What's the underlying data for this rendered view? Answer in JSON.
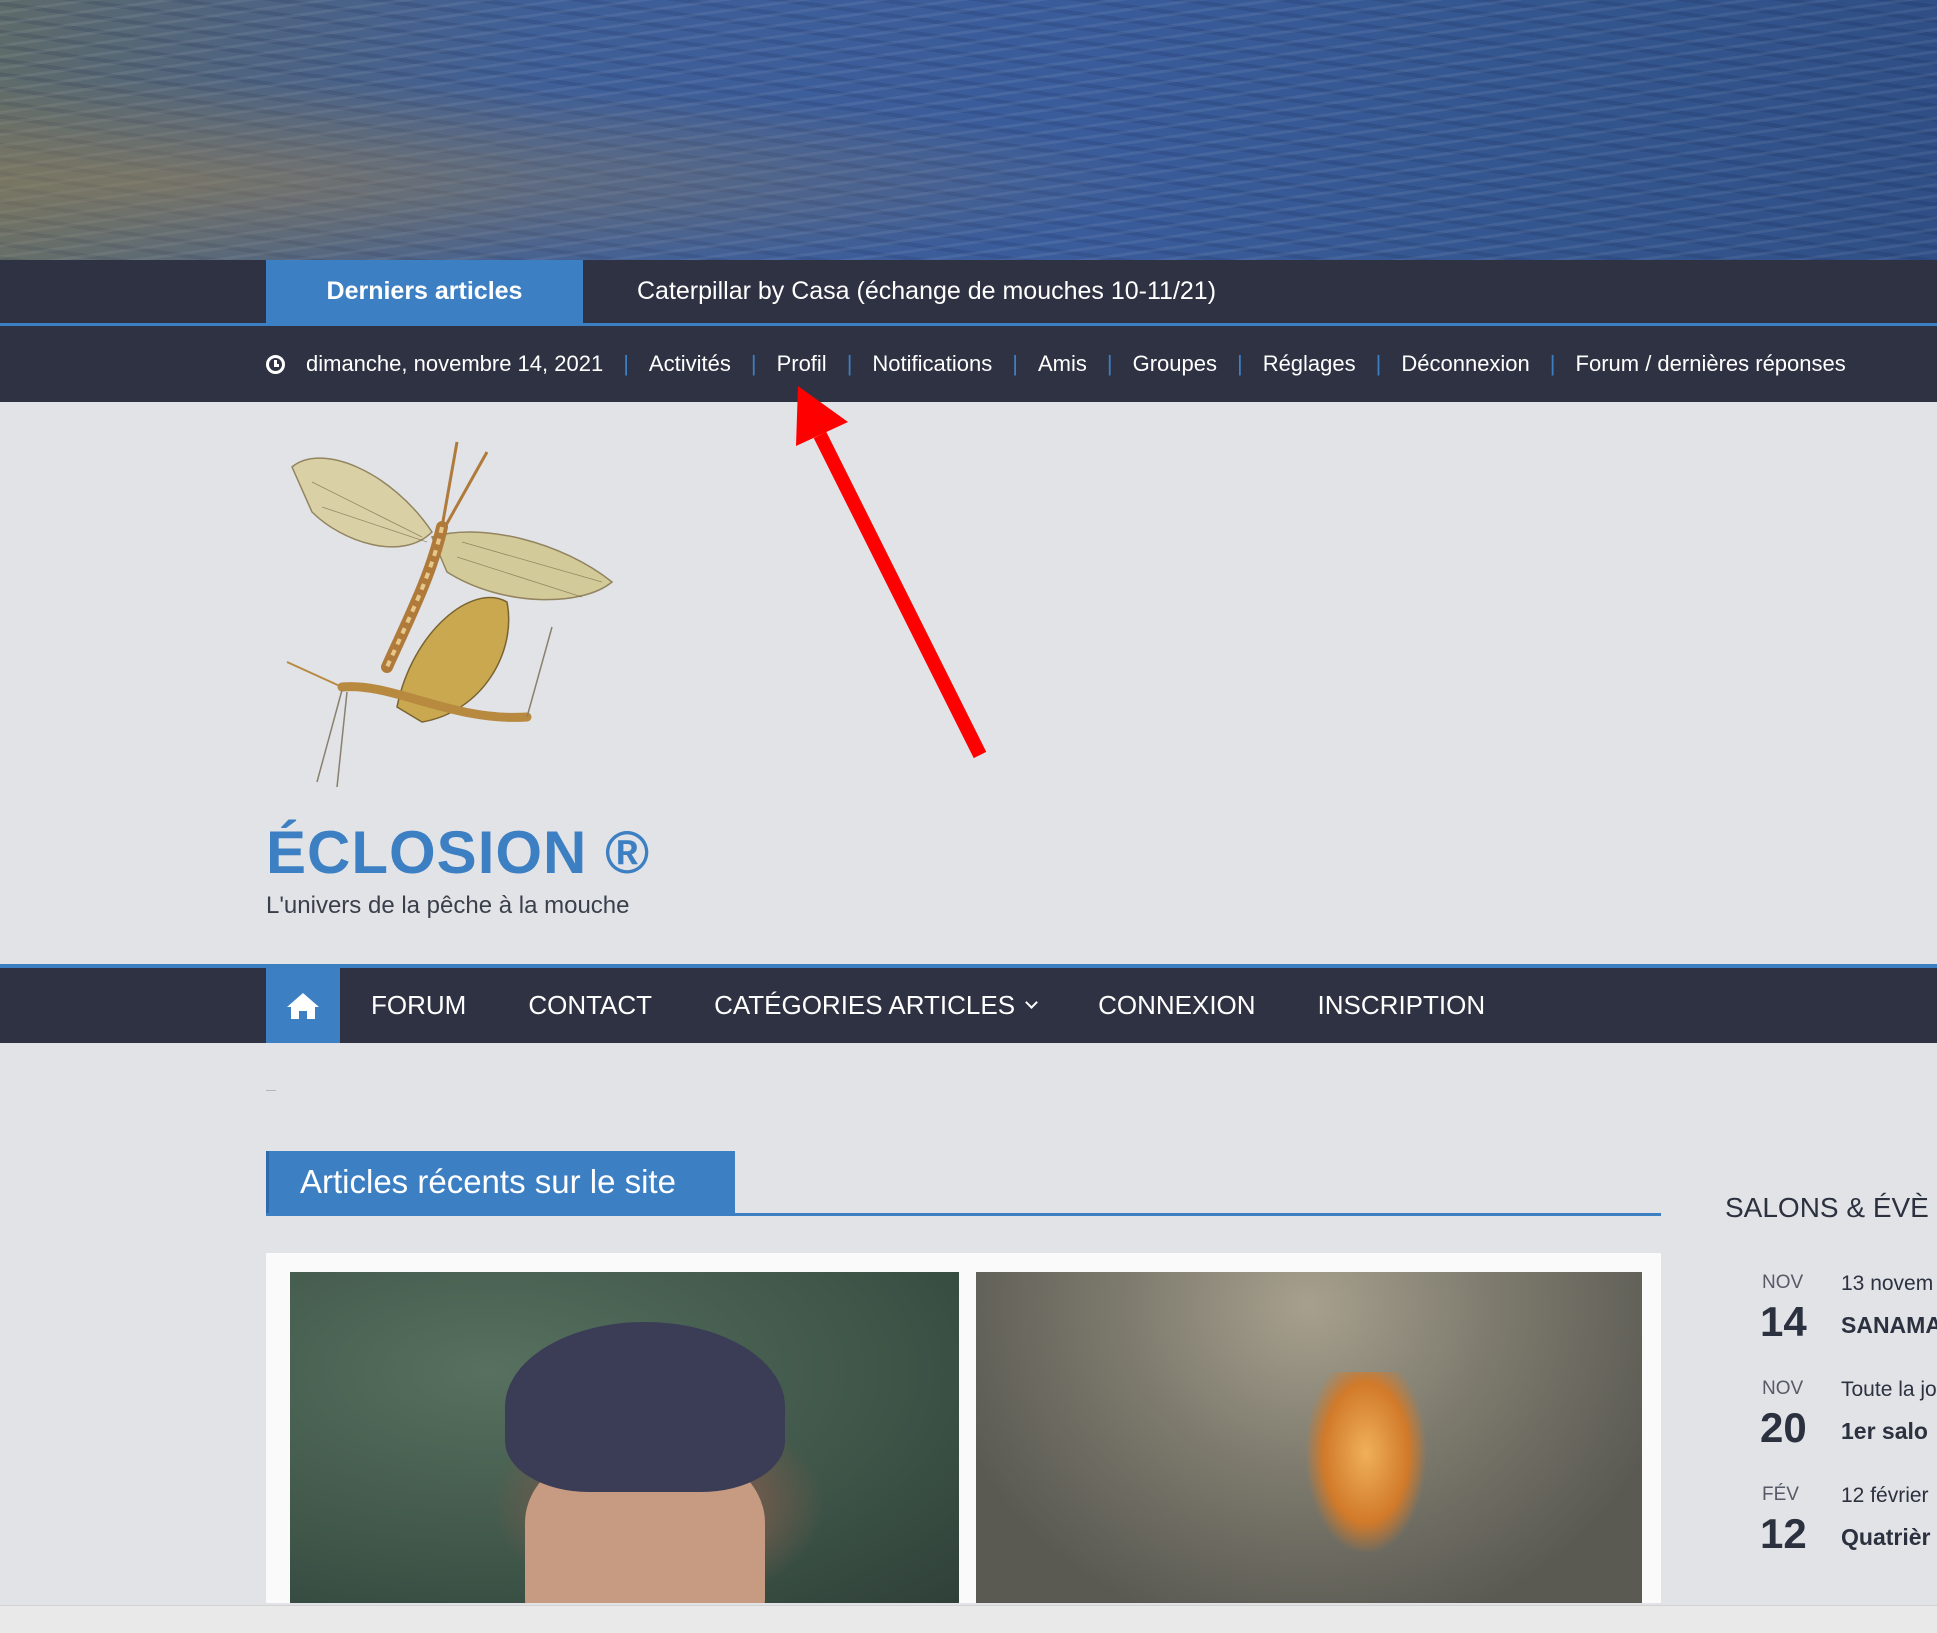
{
  "ticker": {
    "label": "Derniers articles",
    "headline": "Caterpillar by Casa (échange de mouches 10-11/21)"
  },
  "topbar": {
    "date": "dimanche, novembre 14, 2021",
    "links": [
      "Activités",
      "Profil",
      "Notifications",
      "Amis",
      "Groupes",
      "Réglages",
      "Déconnexion",
      "Forum / dernières réponses"
    ]
  },
  "site": {
    "title": "ÉCLOSION ®",
    "tagline": "L'univers de la pêche à la mouche"
  },
  "nav": {
    "items": [
      "FORUM",
      "CONTACT",
      "CATÉGORIES ARTICLES",
      "CONNEXION",
      "INSCRIPTION"
    ]
  },
  "recent": {
    "title": "Articles récents sur le site"
  },
  "events": {
    "title": "SALONS & ÉVÈ",
    "items": [
      {
        "month": "NOV",
        "day": "14",
        "when": "13 novem",
        "name": "SANAMA"
      },
      {
        "month": "NOV",
        "day": "20",
        "when": "Toute la jo",
        "name": "1er salo"
      },
      {
        "month": "FÉV",
        "day": "12",
        "when": "12 février",
        "name": "Quatrièr"
      }
    ]
  },
  "colors": {
    "accent": "#3d7fc3",
    "dark": "#2e3242",
    "arrow": "#ff0000"
  }
}
